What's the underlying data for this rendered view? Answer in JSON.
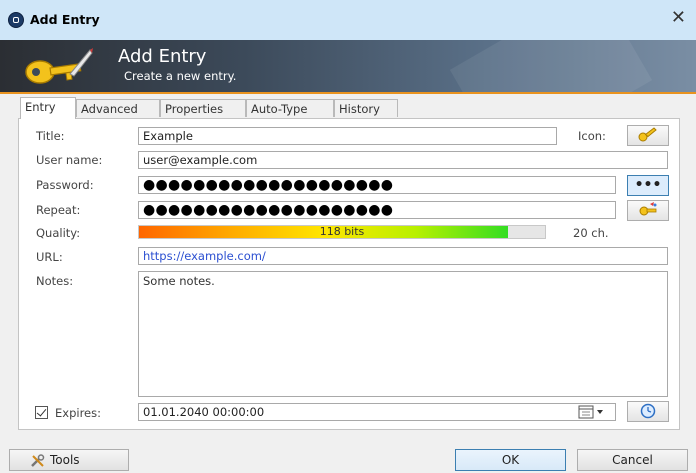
{
  "window": {
    "title": "Add Entry",
    "close_glyph": "✕"
  },
  "banner": {
    "title": "Add Entry",
    "subtitle": "Create a new entry."
  },
  "tabs": [
    {
      "label": "Entry",
      "active": true
    },
    {
      "label": "Advanced",
      "active": false
    },
    {
      "label": "Properties",
      "active": false
    },
    {
      "label": "Auto-Type",
      "active": false
    },
    {
      "label": "History",
      "active": false
    }
  ],
  "entry": {
    "title_label": "Title:",
    "title_value": "Example",
    "icon_label": "Icon:",
    "username_label": "User name:",
    "username_value": "user@example.com",
    "password_label": "Password:",
    "password_mask": "●●●●●●●●●●●●●●●●●●●●",
    "show_password_glyph": "•••",
    "repeat_label": "Repeat:",
    "repeat_mask": "●●●●●●●●●●●●●●●●●●●●",
    "quality_label": "Quality:",
    "quality_text": "118 bits",
    "quality_fraction": 0.91,
    "length_text": "20 ch.",
    "url_label": "URL:",
    "url_value": "https://example.com/",
    "notes_label": "Notes:",
    "notes_value": "Some notes.",
    "expires_label": "Expires:",
    "expires_checked": true,
    "expires_value": "01.01.2040 00:00:00"
  },
  "footer": {
    "tools_label": "Tools",
    "ok_label": "OK",
    "cancel_label": "Cancel"
  },
  "colors": {
    "accent": "#e9931f",
    "title_bar": "#cfe6f8",
    "link": "#2b4fd1"
  }
}
